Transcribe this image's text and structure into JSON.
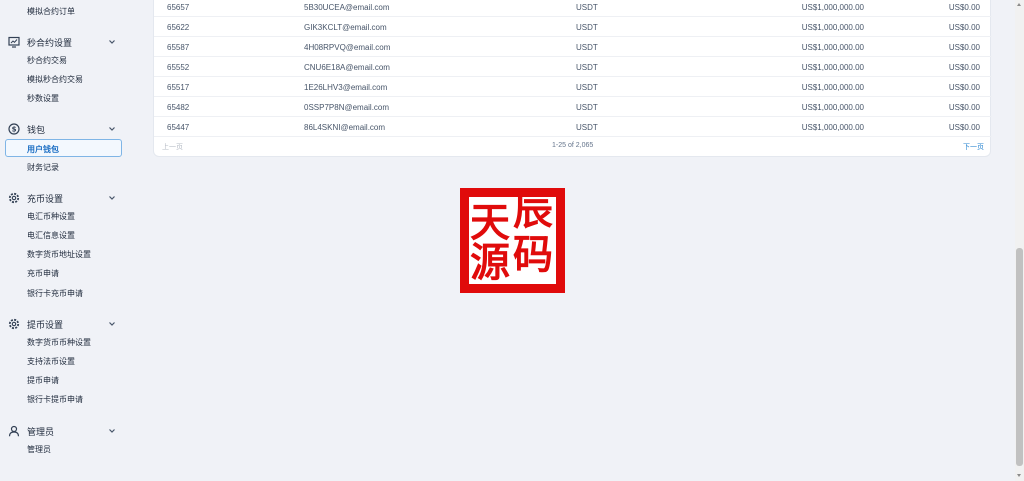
{
  "sidebar": {
    "top_item": "模拟合约订单",
    "groups": [
      {
        "label": "秒合约设置",
        "icon": "chart-board-icon",
        "items": [
          "秒合约交易",
          "模拟秒合约交易",
          "秒数设置"
        ]
      },
      {
        "label": "钱包",
        "icon": "dollar-coin-icon",
        "items": [
          "用户钱包",
          "财务记录"
        ],
        "active": "用户钱包"
      },
      {
        "label": "充币设置",
        "icon": "gear-icon",
        "items": [
          "电汇币种设置",
          "电汇信息设置",
          "数字货币地址设置",
          "充币申请",
          "银行卡充币申请"
        ]
      },
      {
        "label": "提币设置",
        "icon": "gear-icon",
        "items": [
          "数字货币币种设置",
          "支持法币设置",
          "提币申请",
          "银行卡提币申请"
        ]
      },
      {
        "label": "管理员",
        "icon": "user-icon",
        "items": [
          "管理员"
        ]
      }
    ]
  },
  "table": {
    "rows": [
      {
        "id": "65657",
        "email": "5B30UCEA@email.com",
        "currency": "USDT",
        "balance": "US$1,000,000.00",
        "frozen": "US$0.00"
      },
      {
        "id": "65622",
        "email": "GIK3KCLT@email.com",
        "currency": "USDT",
        "balance": "US$1,000,000.00",
        "frozen": "US$0.00"
      },
      {
        "id": "65587",
        "email": "4H08RPVQ@email.com",
        "currency": "USDT",
        "balance": "US$1,000,000.00",
        "frozen": "US$0.00"
      },
      {
        "id": "65552",
        "email": "CNU6E18A@email.com",
        "currency": "USDT",
        "balance": "US$1,000,000.00",
        "frozen": "US$0.00"
      },
      {
        "id": "65517",
        "email": "1E26LHV3@email.com",
        "currency": "USDT",
        "balance": "US$1,000,000.00",
        "frozen": "US$0.00"
      },
      {
        "id": "65482",
        "email": "0SSP7P8N@email.com",
        "currency": "USDT",
        "balance": "US$1,000,000.00",
        "frozen": "US$0.00"
      },
      {
        "id": "65447",
        "email": "86L4SKNI@email.com",
        "currency": "USDT",
        "balance": "US$1,000,000.00",
        "frozen": "US$0.00"
      }
    ]
  },
  "pagination": {
    "prev": "上一页",
    "info": "1-25 of 2,065",
    "next": "下一页"
  },
  "seal": {
    "chars": [
      "天",
      "辰",
      "源",
      "码"
    ],
    "color": "#e00b0b"
  }
}
